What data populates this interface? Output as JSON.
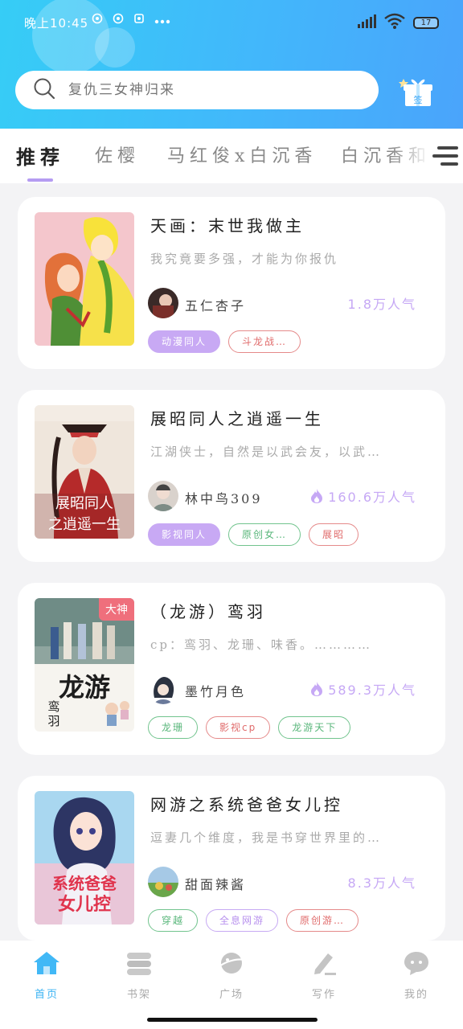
{
  "status_bar": {
    "time": "晚上10:45",
    "battery": "17"
  },
  "search": {
    "placeholder": "复仇三女神归来"
  },
  "sign_in": {
    "label": "签"
  },
  "tabs": [
    {
      "label": "推荐"
    },
    {
      "label": "佐樱"
    },
    {
      "label": "马红俊x白沉香"
    },
    {
      "label": "白沉香和"
    }
  ],
  "books": [
    {
      "title": "天画：末世我做主",
      "description": "我究竟要多强，才能为你报仇",
      "author": "五仁杏子",
      "popularity": "1.8万人气",
      "hot": false,
      "cover_label": "",
      "tags": [
        {
          "label": "动漫同人",
          "style": "purple-fill"
        },
        {
          "label": "斗龙战…",
          "style": "red"
        }
      ]
    },
    {
      "title": "展昭同人之逍遥一生",
      "description": "江湖侠士，自然是以武会友，以武…",
      "author": "林中鸟309",
      "popularity": "160.6万人气",
      "hot": true,
      "cover_label": "",
      "cover_text": "展昭同人之逍遥一生",
      "tags": [
        {
          "label": "影视同人",
          "style": "purple-fill"
        },
        {
          "label": "原创女…",
          "style": "green"
        },
        {
          "label": "展昭",
          "style": "red"
        }
      ]
    },
    {
      "title": "（龙游）鸾羽",
      "description": "cp：鸾羽、龙珊、味香。…………",
      "author": "墨竹月色",
      "popularity": "589.3万人气",
      "hot": true,
      "cover_label": "大神",
      "cover_text": "龙游",
      "tags": [
        {
          "label": "龙珊",
          "style": "green"
        },
        {
          "label": "影视cp",
          "style": "red"
        },
        {
          "label": "龙游天下",
          "style": "green"
        }
      ]
    },
    {
      "title": "网游之系统爸爸女儿控",
      "description": "逗妻几个维度，我是书穿世界里的…",
      "author": "甜面辣酱",
      "popularity": "8.3万人气",
      "hot": false,
      "cover_label": "",
      "cover_text": "系统爸爸女儿控",
      "tags": [
        {
          "label": "穿越",
          "style": "green"
        },
        {
          "label": "全息网游",
          "style": "purple"
        },
        {
          "label": "原创游…",
          "style": "red"
        }
      ]
    }
  ],
  "bottom_nav": [
    {
      "label": "首页",
      "icon": "home-icon",
      "active": true
    },
    {
      "label": "书架",
      "icon": "bookshelf-icon",
      "active": false
    },
    {
      "label": "广场",
      "icon": "planet-icon",
      "active": false
    },
    {
      "label": "写作",
      "icon": "pen-icon",
      "active": false
    },
    {
      "label": "我的",
      "icon": "chat-bubble-icon",
      "active": false
    }
  ],
  "colors": {
    "header_start": "#36cdf6",
    "header_end": "#4aa4fb",
    "accent_purple": "#b59cf2",
    "active_nav": "#3bb3f3"
  }
}
